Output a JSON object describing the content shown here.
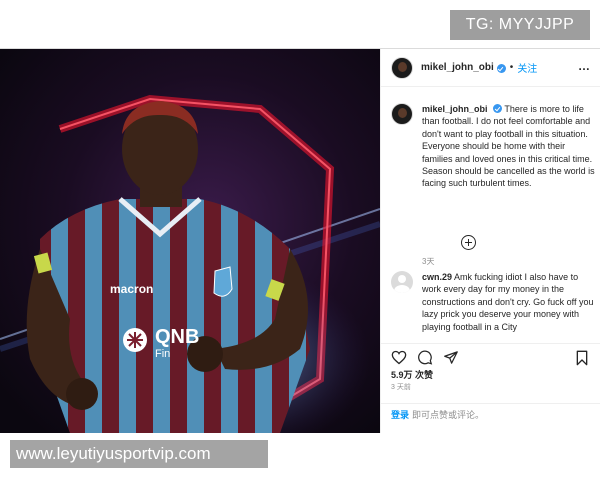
{
  "watermark": {
    "top_right": "TG: MYYJJPP",
    "bottom_left": "www.leyutiyusportvip.com"
  },
  "media": {
    "jersey_brand": "macron",
    "sponsor_main": "QNB",
    "sponsor_sub": "Fin"
  },
  "post": {
    "username": "mikel_john_obi",
    "separator": "•",
    "follow_label": "关注",
    "more_icon": "…",
    "caption": "There is more to life than football. I do not feel comfortable and don't want to play football in this situation. Everyone should be home with their families and loved ones in this critical time. Season should be cancelled as the world is facing such turbulent times.",
    "caption_time": "3天",
    "comment": {
      "username": "cwn.29",
      "text": "Amk fucking idiot I also have to work every day for my money in the constructions and don't cry. Go fuck off you lazy prick you deserve your money with playing football in a City"
    },
    "likes": "5.9万 次赞",
    "date": "3 天前",
    "login_link": "登录",
    "login_rest": "即可点赞或评论。"
  },
  "colors": {
    "link_blue": "#0095f6",
    "verified_blue": "#3897f0",
    "jersey_maroon": "#7a1f2e",
    "jersey_blue": "#5fa8d8",
    "neon_red": "#e0142c"
  }
}
